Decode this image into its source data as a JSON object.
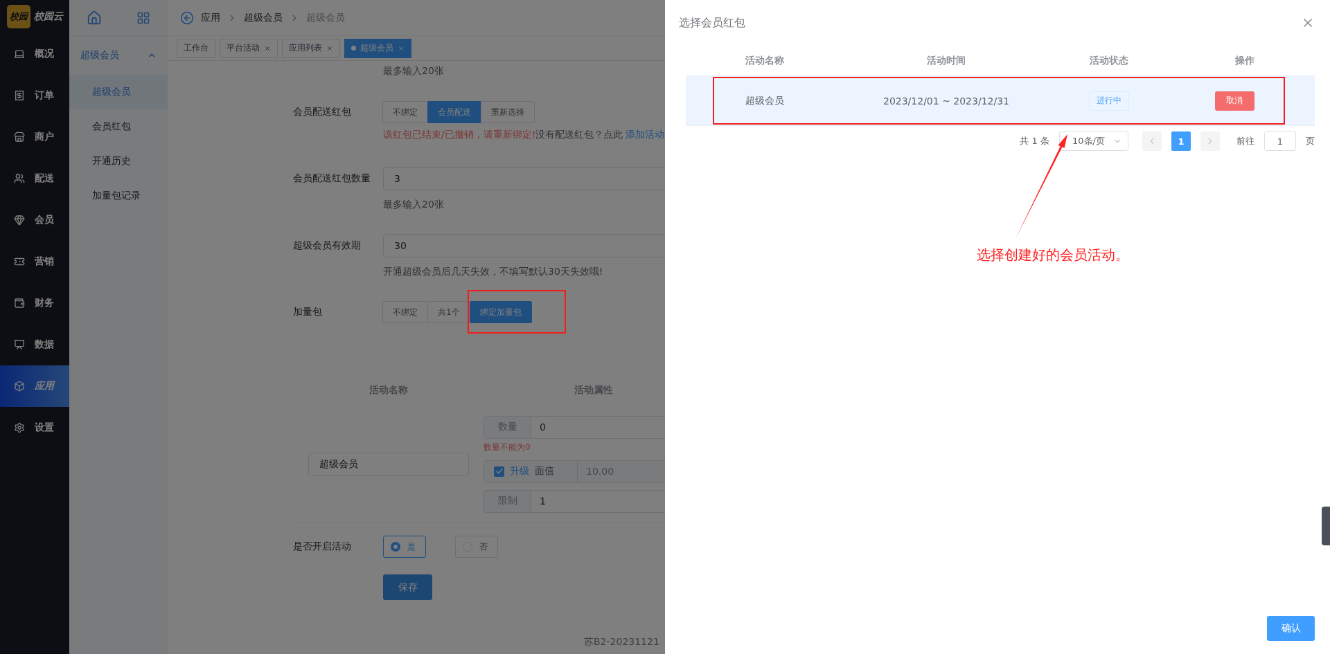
{
  "app": {
    "logo_mark": "校园",
    "logo_text": "校园云"
  },
  "nav": [
    {
      "label": "概况",
      "selected": false
    },
    {
      "label": "订单",
      "selected": false
    },
    {
      "label": "商户",
      "selected": false
    },
    {
      "label": "配送",
      "selected": false
    },
    {
      "label": "会员",
      "selected": false
    },
    {
      "label": "营销",
      "selected": false
    },
    {
      "label": "财务",
      "selected": false
    },
    {
      "label": "数据",
      "selected": false
    },
    {
      "label": "应用",
      "selected": true
    },
    {
      "label": "设置",
      "selected": false
    }
  ],
  "subnav": {
    "title": "超级会员",
    "expanded": true,
    "items": [
      {
        "label": "超级会员",
        "selected": true
      },
      {
        "label": "会员红包",
        "selected": false
      },
      {
        "label": "开通历史",
        "selected": false
      },
      {
        "label": "加量包记录",
        "selected": false
      }
    ]
  },
  "breadcrumb": [
    "应用",
    "超级会员",
    "超级会员"
  ],
  "tabs": [
    {
      "label": "工作台",
      "selected": false,
      "closable": false
    },
    {
      "label": "平台活动",
      "selected": false,
      "closable": true
    },
    {
      "label": "应用列表",
      "selected": false,
      "closable": true
    },
    {
      "label": "超级会员",
      "selected": true,
      "closable": true
    }
  ],
  "form": {
    "top_hint": "最多输入20张",
    "gift_packet": {
      "label": "会员配送红包",
      "options": [
        {
          "label": "不绑定",
          "selected": false
        },
        {
          "label": "会员配送",
          "selected": true
        },
        {
          "label": "重新选择",
          "selected": false
        }
      ],
      "error": "该红包已结束/已撤销，请重新绑定!",
      "note": "没有配送红包？点此",
      "link": "添加活动"
    },
    "gift_count": {
      "label": "会员配送红包数量",
      "value": "3",
      "hint": "最多输入20张"
    },
    "validity": {
      "label": "超级会员有效期",
      "value": "30",
      "hint": "开通超级会员后几天失效，不填写默认30天失效哦!"
    },
    "addon": {
      "label": "加量包",
      "options": [
        {
          "label": "不绑定",
          "selected": false
        },
        {
          "label": "共1个",
          "selected": false
        },
        {
          "label": "绑定加量包",
          "selected": true
        }
      ]
    },
    "activity_table": {
      "columns": [
        "活动名称",
        "活动属性"
      ],
      "name_value": "超级会员",
      "quantity": {
        "label": "数量",
        "value": "0",
        "error": "数量不能为0"
      },
      "upgrade": {
        "checked": true,
        "label": "升级",
        "face_label": "面值",
        "face_value": "10.00",
        "disabled": true
      },
      "limit": {
        "label": "限制",
        "value": "1"
      }
    },
    "enable": {
      "label": "是否开启活动",
      "options": [
        {
          "label": "是",
          "selected": true
        },
        {
          "label": "否",
          "selected": false
        }
      ]
    },
    "save_button": "保存"
  },
  "footer": "苏B2-20231121",
  "drawer": {
    "title": "选择会员红包",
    "columns": [
      "活动名称",
      "活动时间",
      "活动状态",
      "操作"
    ],
    "rows": [
      {
        "name": "超级会员",
        "time": "2023/12/01 ~ 2023/12/31",
        "status": "进行中",
        "action": "取消",
        "selected": true
      }
    ],
    "pagination": {
      "total": "共 1 条",
      "page_size": "10条/页",
      "pages": [
        {
          "label": "1",
          "selected": true
        }
      ],
      "goto_label": "前往",
      "goto_value": "1",
      "page_unit": "页"
    },
    "confirm_button": "确认"
  },
  "annotation": {
    "text": "选择创建好的会员活动。"
  }
}
